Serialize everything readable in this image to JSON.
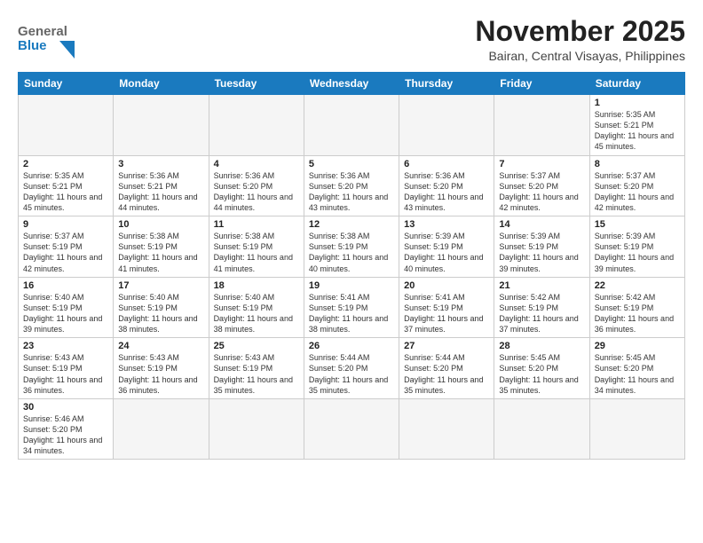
{
  "header": {
    "logo_general": "General",
    "logo_blue": "Blue",
    "month_title": "November 2025",
    "location": "Bairan, Central Visayas, Philippines"
  },
  "weekdays": [
    "Sunday",
    "Monday",
    "Tuesday",
    "Wednesday",
    "Thursday",
    "Friday",
    "Saturday"
  ],
  "days": [
    {
      "date": null,
      "number": "",
      "sunrise": "",
      "sunset": "",
      "daylight": ""
    },
    {
      "date": null,
      "number": "",
      "sunrise": "",
      "sunset": "",
      "daylight": ""
    },
    {
      "date": null,
      "number": "",
      "sunrise": "",
      "sunset": "",
      "daylight": ""
    },
    {
      "date": null,
      "number": "",
      "sunrise": "",
      "sunset": "",
      "daylight": ""
    },
    {
      "date": null,
      "number": "",
      "sunrise": "",
      "sunset": "",
      "daylight": ""
    },
    {
      "date": null,
      "number": "",
      "sunrise": "",
      "sunset": "",
      "daylight": ""
    },
    {
      "date": "1",
      "number": "1",
      "sunrise": "Sunrise: 5:35 AM",
      "sunset": "Sunset: 5:21 PM",
      "daylight": "Daylight: 11 hours and 45 minutes."
    },
    {
      "date": "2",
      "number": "2",
      "sunrise": "Sunrise: 5:35 AM",
      "sunset": "Sunset: 5:21 PM",
      "daylight": "Daylight: 11 hours and 45 minutes."
    },
    {
      "date": "3",
      "number": "3",
      "sunrise": "Sunrise: 5:36 AM",
      "sunset": "Sunset: 5:21 PM",
      "daylight": "Daylight: 11 hours and 44 minutes."
    },
    {
      "date": "4",
      "number": "4",
      "sunrise": "Sunrise: 5:36 AM",
      "sunset": "Sunset: 5:20 PM",
      "daylight": "Daylight: 11 hours and 44 minutes."
    },
    {
      "date": "5",
      "number": "5",
      "sunrise": "Sunrise: 5:36 AM",
      "sunset": "Sunset: 5:20 PM",
      "daylight": "Daylight: 11 hours and 43 minutes."
    },
    {
      "date": "6",
      "number": "6",
      "sunrise": "Sunrise: 5:36 AM",
      "sunset": "Sunset: 5:20 PM",
      "daylight": "Daylight: 11 hours and 43 minutes."
    },
    {
      "date": "7",
      "number": "7",
      "sunrise": "Sunrise: 5:37 AM",
      "sunset": "Sunset: 5:20 PM",
      "daylight": "Daylight: 11 hours and 42 minutes."
    },
    {
      "date": "8",
      "number": "8",
      "sunrise": "Sunrise: 5:37 AM",
      "sunset": "Sunset: 5:20 PM",
      "daylight": "Daylight: 11 hours and 42 minutes."
    },
    {
      "date": "9",
      "number": "9",
      "sunrise": "Sunrise: 5:37 AM",
      "sunset": "Sunset: 5:19 PM",
      "daylight": "Daylight: 11 hours and 42 minutes."
    },
    {
      "date": "10",
      "number": "10",
      "sunrise": "Sunrise: 5:38 AM",
      "sunset": "Sunset: 5:19 PM",
      "daylight": "Daylight: 11 hours and 41 minutes."
    },
    {
      "date": "11",
      "number": "11",
      "sunrise": "Sunrise: 5:38 AM",
      "sunset": "Sunset: 5:19 PM",
      "daylight": "Daylight: 11 hours and 41 minutes."
    },
    {
      "date": "12",
      "number": "12",
      "sunrise": "Sunrise: 5:38 AM",
      "sunset": "Sunset: 5:19 PM",
      "daylight": "Daylight: 11 hours and 40 minutes."
    },
    {
      "date": "13",
      "number": "13",
      "sunrise": "Sunrise: 5:39 AM",
      "sunset": "Sunset: 5:19 PM",
      "daylight": "Daylight: 11 hours and 40 minutes."
    },
    {
      "date": "14",
      "number": "14",
      "sunrise": "Sunrise: 5:39 AM",
      "sunset": "Sunset: 5:19 PM",
      "daylight": "Daylight: 11 hours and 39 minutes."
    },
    {
      "date": "15",
      "number": "15",
      "sunrise": "Sunrise: 5:39 AM",
      "sunset": "Sunset: 5:19 PM",
      "daylight": "Daylight: 11 hours and 39 minutes."
    },
    {
      "date": "16",
      "number": "16",
      "sunrise": "Sunrise: 5:40 AM",
      "sunset": "Sunset: 5:19 PM",
      "daylight": "Daylight: 11 hours and 39 minutes."
    },
    {
      "date": "17",
      "number": "17",
      "sunrise": "Sunrise: 5:40 AM",
      "sunset": "Sunset: 5:19 PM",
      "daylight": "Daylight: 11 hours and 38 minutes."
    },
    {
      "date": "18",
      "number": "18",
      "sunrise": "Sunrise: 5:40 AM",
      "sunset": "Sunset: 5:19 PM",
      "daylight": "Daylight: 11 hours and 38 minutes."
    },
    {
      "date": "19",
      "number": "19",
      "sunrise": "Sunrise: 5:41 AM",
      "sunset": "Sunset: 5:19 PM",
      "daylight": "Daylight: 11 hours and 38 minutes."
    },
    {
      "date": "20",
      "number": "20",
      "sunrise": "Sunrise: 5:41 AM",
      "sunset": "Sunset: 5:19 PM",
      "daylight": "Daylight: 11 hours and 37 minutes."
    },
    {
      "date": "21",
      "number": "21",
      "sunrise": "Sunrise: 5:42 AM",
      "sunset": "Sunset: 5:19 PM",
      "daylight": "Daylight: 11 hours and 37 minutes."
    },
    {
      "date": "22",
      "number": "22",
      "sunrise": "Sunrise: 5:42 AM",
      "sunset": "Sunset: 5:19 PM",
      "daylight": "Daylight: 11 hours and 36 minutes."
    },
    {
      "date": "23",
      "number": "23",
      "sunrise": "Sunrise: 5:43 AM",
      "sunset": "Sunset: 5:19 PM",
      "daylight": "Daylight: 11 hours and 36 minutes."
    },
    {
      "date": "24",
      "number": "24",
      "sunrise": "Sunrise: 5:43 AM",
      "sunset": "Sunset: 5:19 PM",
      "daylight": "Daylight: 11 hours and 36 minutes."
    },
    {
      "date": "25",
      "number": "25",
      "sunrise": "Sunrise: 5:43 AM",
      "sunset": "Sunset: 5:19 PM",
      "daylight": "Daylight: 11 hours and 35 minutes."
    },
    {
      "date": "26",
      "number": "26",
      "sunrise": "Sunrise: 5:44 AM",
      "sunset": "Sunset: 5:20 PM",
      "daylight": "Daylight: 11 hours and 35 minutes."
    },
    {
      "date": "27",
      "number": "27",
      "sunrise": "Sunrise: 5:44 AM",
      "sunset": "Sunset: 5:20 PM",
      "daylight": "Daylight: 11 hours and 35 minutes."
    },
    {
      "date": "28",
      "number": "28",
      "sunrise": "Sunrise: 5:45 AM",
      "sunset": "Sunset: 5:20 PM",
      "daylight": "Daylight: 11 hours and 35 minutes."
    },
    {
      "date": "29",
      "number": "29",
      "sunrise": "Sunrise: 5:45 AM",
      "sunset": "Sunset: 5:20 PM",
      "daylight": "Daylight: 11 hours and 34 minutes."
    },
    {
      "date": "30",
      "number": "30",
      "sunrise": "Sunrise: 5:46 AM",
      "sunset": "Sunset: 5:20 PM",
      "daylight": "Daylight: 11 hours and 34 minutes."
    },
    {
      "date": null,
      "number": "",
      "sunrise": "",
      "sunset": "",
      "daylight": ""
    },
    {
      "date": null,
      "number": "",
      "sunrise": "",
      "sunset": "",
      "daylight": ""
    },
    {
      "date": null,
      "number": "",
      "sunrise": "",
      "sunset": "",
      "daylight": ""
    },
    {
      "date": null,
      "number": "",
      "sunrise": "",
      "sunset": "",
      "daylight": ""
    },
    {
      "date": null,
      "number": "",
      "sunrise": "",
      "sunset": "",
      "daylight": ""
    },
    {
      "date": null,
      "number": "",
      "sunrise": "",
      "sunset": "",
      "daylight": ""
    }
  ]
}
